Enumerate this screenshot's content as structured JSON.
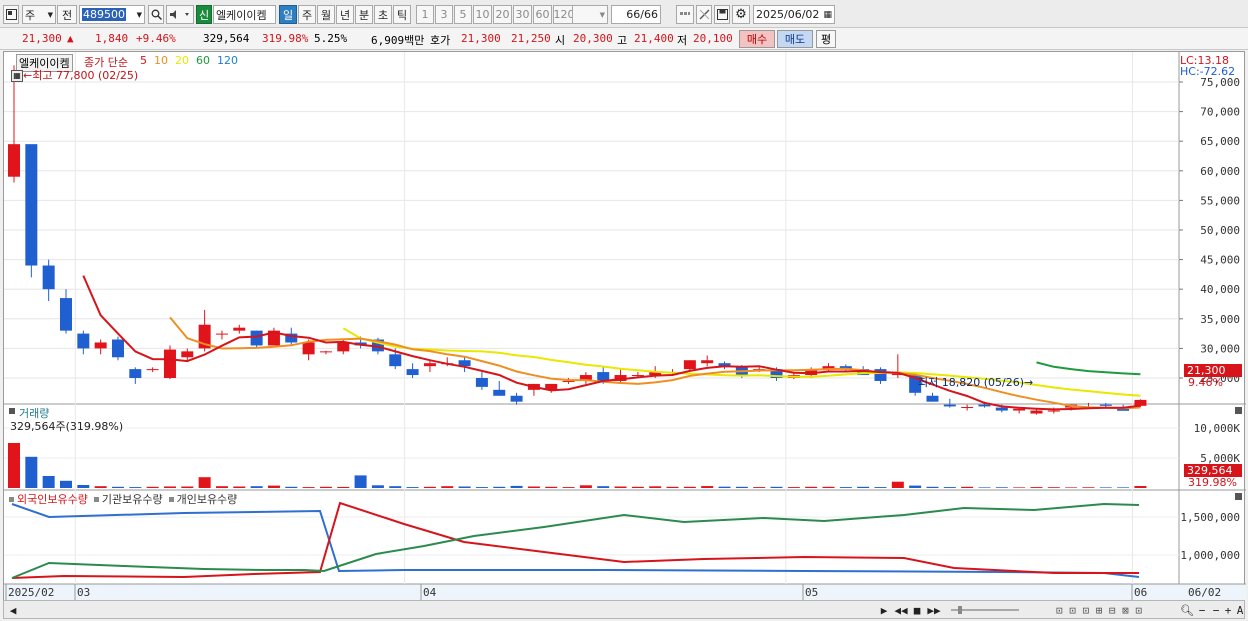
{
  "toolbar": {
    "period_type": "주",
    "prev_label": "전",
    "stock_code": "489500",
    "badge": "신",
    "stock_name": "엘케이이켐",
    "period_buttons": [
      "일",
      "주",
      "월",
      "년",
      "분",
      "초",
      "틱"
    ],
    "active_period": "일",
    "interval_buttons": [
      "1",
      "3",
      "5",
      "10",
      "20",
      "30",
      "60",
      "120"
    ],
    "count": "66",
    "count_total": "/66",
    "date": "2025/06/02"
  },
  "infobar": {
    "price": "21,300",
    "up_marker": "▲",
    "change": "1,840",
    "change_pct": "+9.46%",
    "volume": "329,564",
    "volume_ratio": "319.98%",
    "turnover": "5.25%",
    "trade_value": "6,909백만",
    "ask_label": "호가",
    "ask1": "21,300",
    "ask2": "21,250",
    "open_label": "시",
    "open": "20,300",
    "high_label": "고",
    "high": "21,400",
    "low_label": "저",
    "low": "20,100",
    "buy_label": "매수",
    "sell_label": "매도",
    "flat_label": "평"
  },
  "price_panel": {
    "name_tab": "엘케이이켐",
    "ma_label": "종가 단순",
    "ma_periods": [
      "5",
      "10",
      "20",
      "60",
      "120"
    ],
    "ma_colors": [
      "#d6141a",
      "#ef8f22",
      "#e8e800",
      "#1e9a3c",
      "#1e7fd2"
    ],
    "high_marker": "←최고 77,800 (02/25)",
    "low_marker": "최저 18,820 (05/26)→",
    "lc": "LC:13.18",
    "hc": "HC:-72.62",
    "current_price_tag": "21,300",
    "current_pct_tag": "9.46%",
    "y_ticks": [
      "75,000",
      "70,000",
      "65,000",
      "60,000",
      "55,000",
      "50,000",
      "45,000",
      "40,000",
      "35,000",
      "30,000",
      "25,000"
    ]
  },
  "volume_panel": {
    "title": "거래량",
    "current": "329,564주(319.98%)",
    "y_ticks": [
      "10,000K",
      "5,000K"
    ],
    "tag_value": "329,564",
    "tag_pct": "319.98%"
  },
  "holding_panel": {
    "legend": [
      "외국인보유수량",
      "기관보유수량",
      "개인보유수량"
    ],
    "colors": [
      "#d6141a",
      "#2e6fd0",
      "#2b8a4e"
    ],
    "y_ticks": [
      "1,500,000",
      "1,000,000"
    ]
  },
  "x_axis": {
    "labels": [
      "2025/02",
      "03",
      "04",
      "05",
      "06"
    ],
    "right_label": "06/02"
  },
  "chart_data": {
    "type": "candlestick",
    "dates_first": "2025/02/25",
    "candles": [
      [
        59000,
        77800,
        58000,
        64500
      ],
      [
        64500,
        63000,
        42000,
        44000
      ],
      [
        44000,
        45000,
        38000,
        40000
      ],
      [
        38500,
        40000,
        32500,
        33000
      ],
      [
        32500,
        33000,
        29000,
        30000
      ],
      [
        30000,
        31500,
        29000,
        31000
      ],
      [
        31500,
        32000,
        28000,
        28500
      ],
      [
        26500,
        26800,
        24000,
        25000
      ],
      [
        26500,
        26800,
        26000,
        26500
      ],
      [
        25000,
        30500,
        24800,
        29800
      ],
      [
        28500,
        30000,
        28000,
        29500
      ],
      [
        30000,
        36500,
        29500,
        34000
      ],
      [
        32500,
        33000,
        31500,
        32500
      ],
      [
        33000,
        34000,
        32500,
        33500
      ],
      [
        33000,
        33000,
        30000,
        30500
      ],
      [
        30500,
        33500,
        30500,
        33000
      ],
      [
        32500,
        33500,
        30500,
        31000
      ],
      [
        29000,
        31500,
        28000,
        31000
      ],
      [
        29500,
        29600,
        29000,
        29500
      ],
      [
        29500,
        31500,
        29000,
        31000
      ],
      [
        31000,
        32000,
        30000,
        30500
      ],
      [
        31500,
        31800,
        29000,
        29500
      ],
      [
        29000,
        30000,
        26500,
        27000
      ],
      [
        26500,
        27500,
        25000,
        25500
      ],
      [
        27000,
        28000,
        26000,
        27500
      ],
      [
        27500,
        28500,
        27000,
        27500
      ],
      [
        28000,
        28500,
        26000,
        27000
      ],
      [
        25000,
        26000,
        23000,
        23500
      ],
      [
        23000,
        24500,
        22000,
        22000
      ],
      [
        22000,
        22500,
        20500,
        21000
      ],
      [
        23000,
        24000,
        22000,
        24000
      ],
      [
        23000,
        24000,
        22500,
        24000
      ],
      [
        24500,
        25000,
        24000,
        24500
      ],
      [
        24500,
        26000,
        24000,
        25500
      ],
      [
        26000,
        27000,
        24000,
        24500
      ],
      [
        24500,
        26500,
        24000,
        25500
      ],
      [
        25500,
        26000,
        25000,
        25500
      ],
      [
        25500,
        27000,
        25000,
        26000
      ],
      [
        26000,
        26500,
        25500,
        26000
      ],
      [
        26500,
        28000,
        26000,
        28000
      ],
      [
        27500,
        28800,
        27000,
        28000
      ],
      [
        27500,
        27800,
        26500,
        27000
      ],
      [
        27000,
        27200,
        25000,
        25500
      ],
      [
        26500,
        27000,
        26000,
        26500
      ],
      [
        26500,
        26800,
        24500,
        25000
      ],
      [
        25000,
        26000,
        24800,
        25500
      ],
      [
        25500,
        26800,
        25000,
        26500
      ],
      [
        26500,
        27500,
        26000,
        27000
      ],
      [
        27000,
        27300,
        26000,
        26500
      ],
      [
        26500,
        27000,
        25500,
        25500
      ],
      [
        26500,
        26800,
        24000,
        24500
      ],
      [
        25500,
        29000,
        25000,
        26000
      ],
      [
        25500,
        26000,
        22000,
        22500
      ],
      [
        22000,
        22500,
        21000,
        21000
      ],
      [
        20500,
        21500,
        20000,
        20200
      ],
      [
        20000,
        20500,
        19500,
        20100
      ],
      [
        20500,
        21000,
        20000,
        20200
      ],
      [
        20000,
        20500,
        19200,
        19500
      ],
      [
        19500,
        20000,
        19000,
        19800
      ],
      [
        19000,
        19800,
        18820,
        19500
      ],
      [
        19500,
        20000,
        19000,
        19500
      ],
      [
        20000,
        20500,
        19500,
        20500
      ],
      [
        20000,
        20800,
        19800,
        20100
      ],
      [
        20500,
        20800,
        20000,
        20300
      ],
      [
        20000,
        20500,
        19800,
        19460
      ],
      [
        20300,
        21400,
        20100,
        21300
      ]
    ],
    "volume_k": [
      7500,
      5200,
      2000,
      1200,
      500,
      300,
      200,
      150,
      200,
      260,
      250,
      1800,
      300,
      250,
      300,
      400,
      200,
      150,
      200,
      180,
      2100,
      450,
      300,
      150,
      200,
      300,
      250,
      150,
      200,
      350,
      250,
      200,
      150,
      450,
      300,
      250,
      200,
      280,
      200,
      200,
      320,
      220,
      200,
      150,
      200,
      150,
      200,
      200,
      150,
      200,
      150,
      1050,
      400,
      200,
      150,
      200,
      100,
      120,
      100,
      150,
      130,
      100,
      120,
      100,
      103,
      330
    ]
  }
}
